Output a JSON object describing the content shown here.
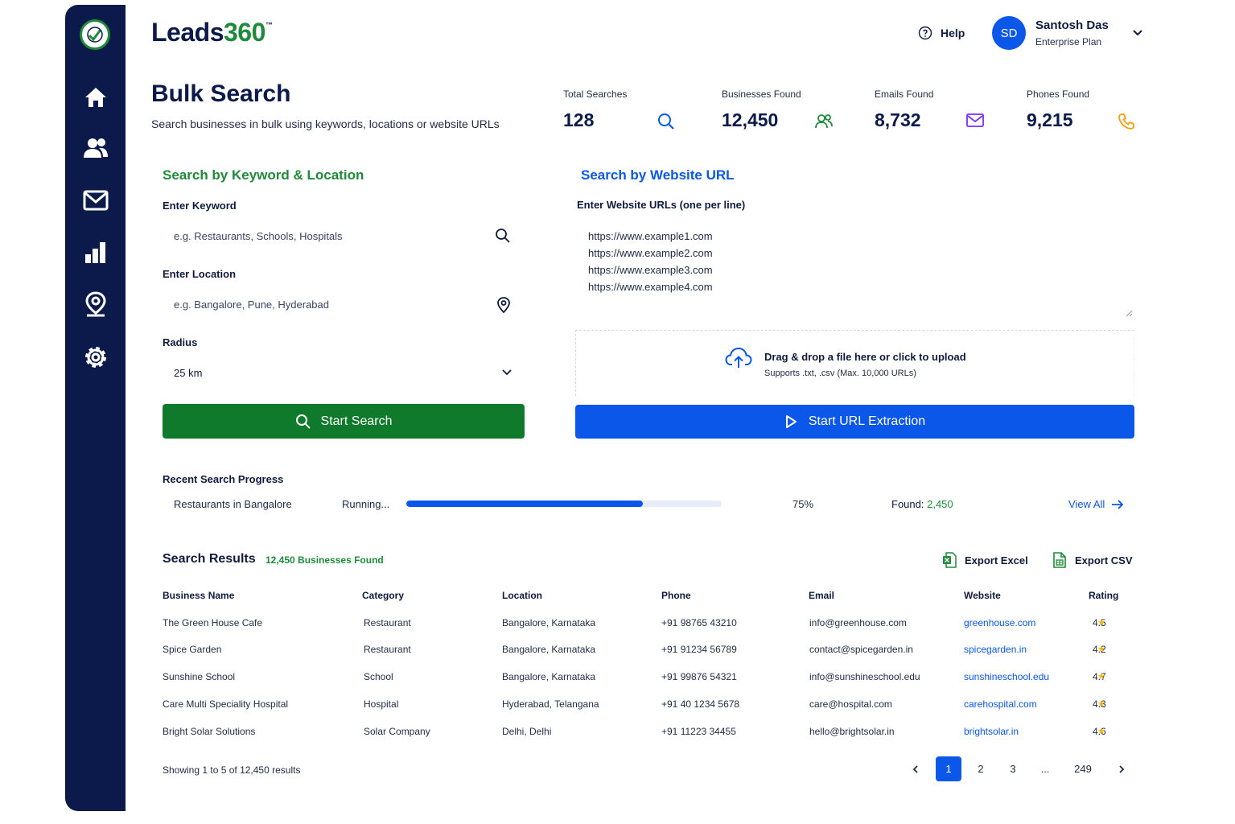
{
  "brand": {
    "part1": "Leads",
    "part2": "360",
    "tm": "™"
  },
  "header": {
    "help_label": "Help",
    "user_initials": "SD",
    "user_name": "Santosh Das",
    "user_plan": "Enterprise Plan"
  },
  "page": {
    "title": "Bulk Search",
    "subtitle": "Search businesses in bulk using keywords, locations or website URLs"
  },
  "stats": [
    {
      "label": "Total Searches",
      "value": "128",
      "icon": "search-icon",
      "color": "#0a57ea"
    },
    {
      "label": "Businesses Found",
      "value": "12,450",
      "icon": "users-icon",
      "color": "#1f8a3a"
    },
    {
      "label": "Emails Found",
      "value": "8,732",
      "icon": "mail-icon",
      "color": "#7b2ff7"
    },
    {
      "label": "Phones Found",
      "value": "9,215",
      "icon": "phone-icon",
      "color": "#f59e0b"
    }
  ],
  "keyword_section": {
    "title": "Search by Keyword & Location",
    "keyword_label": "Enter Keyword",
    "keyword_placeholder": "e.g. Restaurants, Schools, Hospitals",
    "location_label": "Enter Location",
    "location_placeholder": "e.g. Bangalore, Pune, Hyderabad",
    "radius_label": "Radius",
    "radius_value": "25 km",
    "button_label": "Start Search"
  },
  "url_section": {
    "title": "Search by Website URL",
    "urls_label": "Enter Website URLs (one per line)",
    "urls": [
      "https://www.example1.com",
      "https://www.example2.com",
      "https://www.example3.com",
      "https://www.example4.com"
    ],
    "upload_title": "Drag & drop a file here or click to upload",
    "upload_hint": "Supports .txt, .csv (Max. 10,000 URLs)",
    "button_label": "Start URL Extraction"
  },
  "progress": {
    "title": "Recent Search Progress",
    "query": "Restaurants in Bangalore",
    "status": "Running...",
    "percent_value": 0.75,
    "percent_label": "75%",
    "found_label": "Found:",
    "found_value": "2,450",
    "view_all": "View All"
  },
  "results": {
    "title": "Search Results",
    "count_label": "12,450 Businesses Found",
    "export_excel": "Export Excel",
    "export_csv": "Export CSV",
    "columns": [
      "Business Name",
      "Category",
      "Location",
      "Phone",
      "Email",
      "Website",
      "Rating"
    ],
    "rows": [
      [
        "The Green House Cafe",
        "Restaurant",
        "Bangalore, Karnataka",
        "+91 98765 43210",
        "info@greenhouse.com",
        "greenhouse.com",
        "4.5"
      ],
      [
        "Spice Garden",
        "Restaurant",
        "Bangalore, Karnataka",
        "+91 91234 56789",
        "contact@spicegarden.in",
        "spicegarden.in",
        "4.2"
      ],
      [
        "Sunshine School",
        "School",
        "Bangalore, Karnataka",
        "+91 99876 54321",
        "info@sunshineschool.edu",
        "sunshineschool.edu",
        "4.7"
      ],
      [
        "Care Multi Speciality Hospital",
        "Hospital",
        "Hyderabad, Telangana",
        "+91 40 1234 5678",
        "care@hospital.com",
        "carehospital.com",
        "4.3"
      ],
      [
        "Bright Solar Solutions",
        "Solar Company",
        "Delhi, Delhi",
        "+91 11223 34455",
        "hello@brightsolar.in",
        "brightsolar.in",
        "4.6"
      ]
    ],
    "showing": "Showing 1 to 5 of 12,450 results",
    "pages": [
      "1",
      "2",
      "3",
      "...",
      "249"
    ],
    "active_page": "1"
  },
  "colors": {
    "sidebar": "#0b1a4a",
    "green": "#1f8a3a",
    "blue": "#0a57ea"
  }
}
